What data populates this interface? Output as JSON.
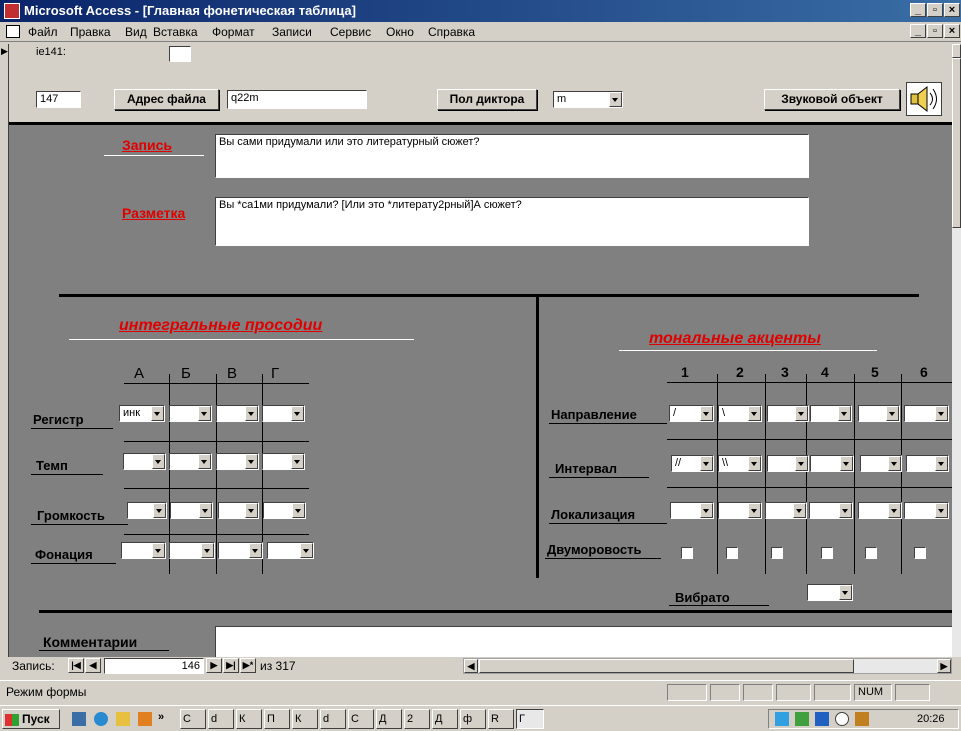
{
  "window": {
    "title": "Microsoft Access - [Главная фонетическая таблица]"
  },
  "menu": [
    "Файл",
    "Правка",
    "Вид",
    "Вставка",
    "Формат",
    "Записи",
    "Сервис",
    "Окно",
    "Справка"
  ],
  "header": {
    "field_label_partial": "ie141:",
    "id_value": "147",
    "file_address_button": "Адрес файла",
    "file_address_value": "q22m",
    "speaker_gender_button": "Пол диктора",
    "speaker_gender_value": "m",
    "sound_object_button": "Звуковой объект"
  },
  "record": {
    "zapis_label": "Запись",
    "zapis_value": "Вы сами придумали или это литературный сюжет?",
    "razmetka_label": "Разметка",
    "razmetka_value": "Вы *са1ми придумали? [Или это *литерату2рный]А сюжет?"
  },
  "integral": {
    "title": "интегральные просодии",
    "columns": [
      "А",
      "Б",
      "В",
      "Г"
    ],
    "rows": [
      {
        "label": "Регистр",
        "values": [
          "инк",
          "",
          "",
          ""
        ]
      },
      {
        "label": "Темп",
        "values": [
          "",
          "",
          "",
          ""
        ]
      },
      {
        "label": "Громкость",
        "values": [
          "",
          "",
          "",
          ""
        ]
      },
      {
        "label": "Фонация",
        "values": [
          "",
          "",
          "",
          ""
        ]
      }
    ]
  },
  "tonal": {
    "title": "тональные акценты",
    "columns": [
      "1",
      "2",
      "3",
      "4",
      "5",
      "6"
    ],
    "direction_label": "Направление",
    "direction_values": [
      "/",
      "\\",
      "",
      "",
      "",
      ""
    ],
    "interval_label": "Интервал",
    "interval_values": [
      "//",
      "\\\\",
      "",
      "",
      "",
      ""
    ],
    "localization_label": "Локализация",
    "dvumorovost_label": "Двуморовость",
    "vibrato_label": "Вибрато"
  },
  "comments": {
    "label": "Комментарии",
    "value": ""
  },
  "nav": {
    "record_label": "Запись:",
    "current": "146",
    "of_text": "из 317"
  },
  "status": {
    "mode": "Режим формы",
    "num": "NUM"
  },
  "taskbar": {
    "start": "Пуск",
    "buttons": [
      "С",
      "d",
      "К",
      "П",
      "К",
      "d",
      "С",
      "Д",
      "2",
      "Д",
      "ф",
      "R",
      "Г"
    ],
    "clock": "20:26"
  },
  "colors": {
    "form_bg": "#808080",
    "accent_red": "#e00000",
    "title_blue": "#0a246a"
  }
}
